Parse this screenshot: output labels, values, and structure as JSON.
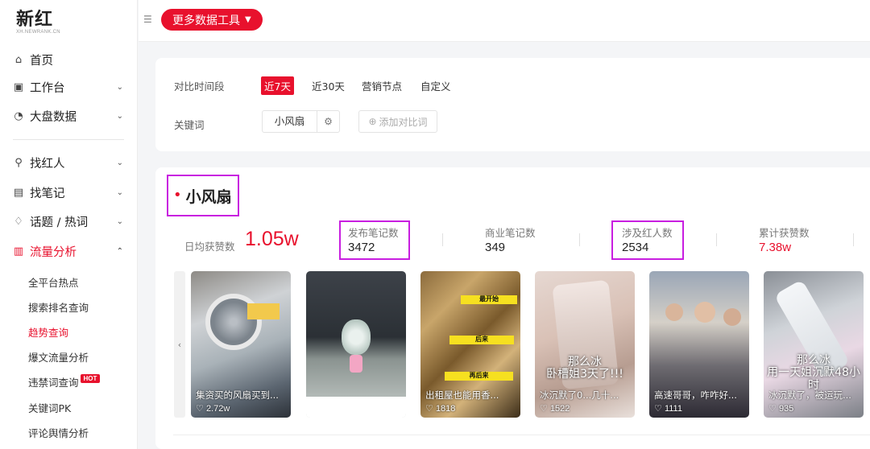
{
  "logo": {
    "main": "新红",
    "sub": "XH.NEWRANK.CN"
  },
  "nav": {
    "items": [
      {
        "label": "首页",
        "icon": "home-icon",
        "chevron": ""
      },
      {
        "label": "工作台",
        "icon": "workbench-icon",
        "chevron": "⌄"
      },
      {
        "label": "大盘数据",
        "icon": "dashboard-icon",
        "chevron": "⌄"
      },
      {
        "label": "找红人",
        "icon": "search-icon",
        "chevron": "⌄"
      },
      {
        "label": "找笔记",
        "icon": "note-icon",
        "chevron": "⌄"
      },
      {
        "label": "话题 / 热词",
        "icon": "topic-icon",
        "chevron": "⌄"
      },
      {
        "label": "流量分析",
        "icon": "analytics-icon",
        "chevron": "⌃"
      }
    ],
    "sub_items": [
      "全平台热点",
      "搜索排名查询",
      "趋势查询",
      "爆文流量分析",
      "违禁词查询",
      "关键词PK",
      "评论舆情分析"
    ],
    "hot_badge": "HOT"
  },
  "topbar": {
    "tools_label": "更多数据工具"
  },
  "filter": {
    "period_label": "对比时间段",
    "periods": [
      "近7天",
      "近30天",
      "营销节点",
      "自定义"
    ],
    "keyword_label": "关键词",
    "keyword": "小风扇",
    "add_compare": "添加对比词"
  },
  "result": {
    "keyword": "小风扇",
    "daily_likes_label": "日均获赞数",
    "daily_likes": "1.05w",
    "stats": [
      {
        "label": "发布笔记数",
        "value": "3472"
      },
      {
        "label": "商业笔记数",
        "value": "349"
      },
      {
        "label": "涉及红人数",
        "value": "2534"
      },
      {
        "label": "累计获赞数",
        "value": "7.38w"
      }
    ]
  },
  "notes": [
    {
      "caption": "集资买的风扇买到...",
      "likes": "2.72w",
      "overlay": ""
    },
    {
      "caption": "",
      "likes": "",
      "overlay": ""
    },
    {
      "caption": "出租屋也能用香...",
      "likes": "1818",
      "overlay": ""
    },
    {
      "caption": "冰沉默了0...几十...",
      "likes": "1522",
      "overlay": "那么冰\n卧槽姐3天了!!!"
    },
    {
      "caption": "高速哥哥，咋咋好...",
      "likes": "1111",
      "overlay": ""
    },
    {
      "caption": "冰沉默了，被运玩...",
      "likes": "935",
      "overlay": "那么冰\n用一天姐沉默48小时"
    }
  ],
  "colors": {
    "accent": "#e8112d",
    "highlight": "#c81ee0"
  }
}
